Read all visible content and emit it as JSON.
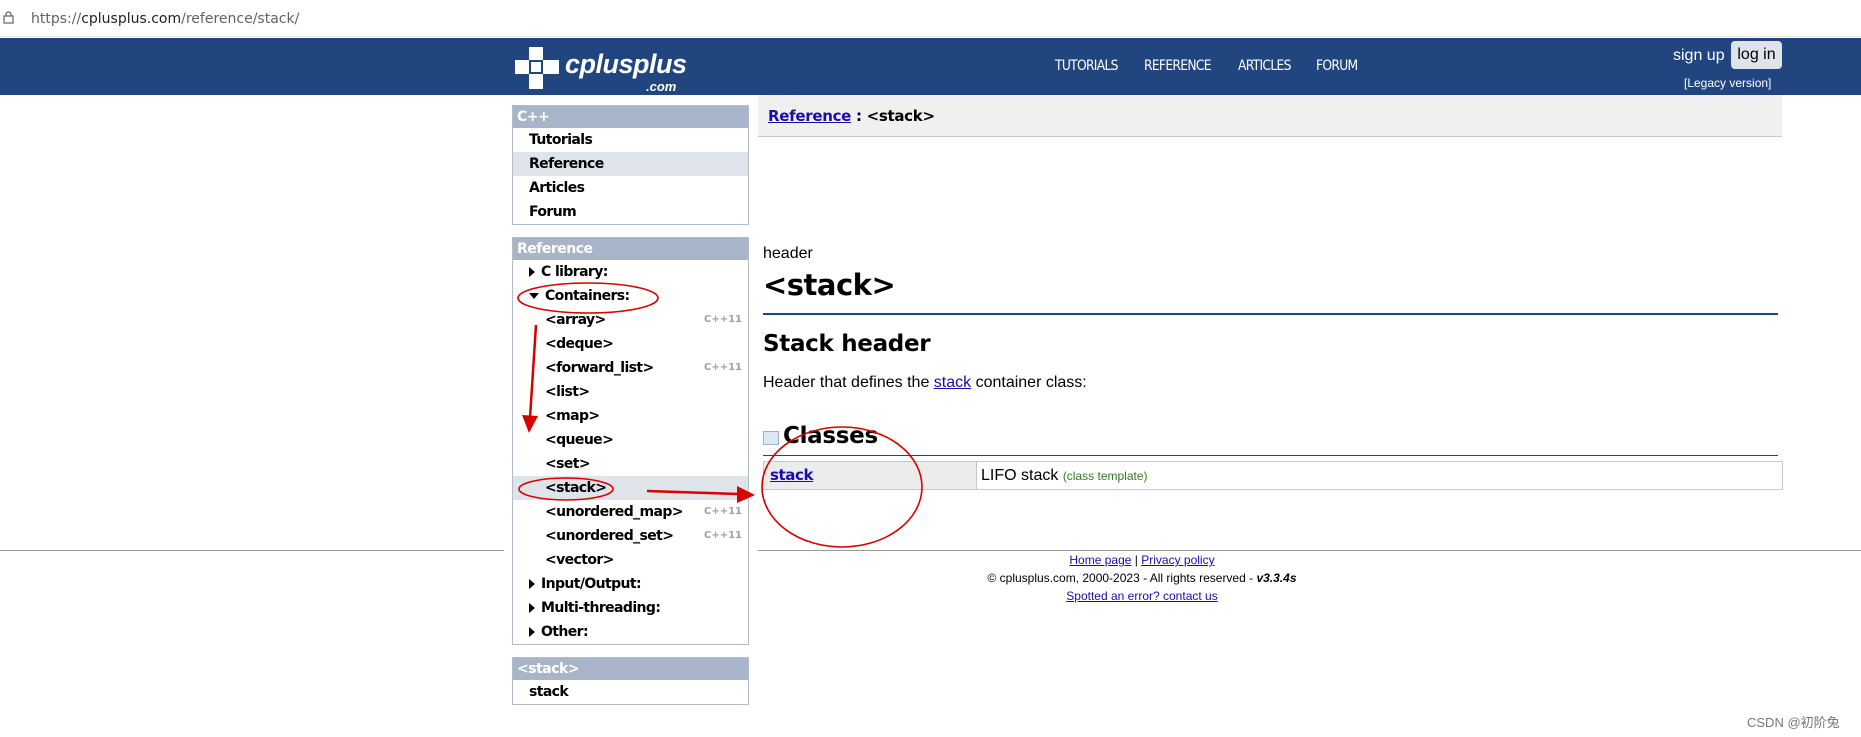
{
  "browser": {
    "url_prefix": "https://",
    "url_domain": "cplusplus.com",
    "url_path": "/reference/stack/"
  },
  "header": {
    "logo_text": "cplusplus",
    "logo_domain": ".com",
    "nav": [
      "TUTORIALS",
      "REFERENCE",
      "ARTICLES",
      "FORUM"
    ],
    "sign_up": "sign up",
    "log_in": "log in",
    "legacy": "[Legacy version]"
  },
  "sidebar": {
    "cpp_box": {
      "title": "C++",
      "items": [
        "Tutorials",
        "Reference",
        "Articles",
        "Forum"
      ],
      "selected": "Reference"
    },
    "ref_box": {
      "title": "Reference",
      "c_library": "C library:",
      "containers": "Containers:",
      "containers_items": [
        {
          "label": "<array>",
          "badge": "C++11"
        },
        {
          "label": "<deque>",
          "badge": ""
        },
        {
          "label": "<forward_list>",
          "badge": "C++11"
        },
        {
          "label": "<list>",
          "badge": ""
        },
        {
          "label": "<map>",
          "badge": ""
        },
        {
          "label": "<queue>",
          "badge": ""
        },
        {
          "label": "<set>",
          "badge": ""
        },
        {
          "label": "<stack>",
          "badge": ""
        },
        {
          "label": "<unordered_map>",
          "badge": "C++11"
        },
        {
          "label": "<unordered_set>",
          "badge": "C++11"
        },
        {
          "label": "<vector>",
          "badge": ""
        }
      ],
      "input_output": "Input/Output:",
      "multi_threading": "Multi-threading:",
      "other": "Other:"
    },
    "stack_box": {
      "title": "<stack>",
      "items": [
        "stack"
      ]
    }
  },
  "main": {
    "breadcrumb_link": "Reference",
    "breadcrumb_sep": " : ",
    "breadcrumb_current": "<stack>",
    "kind": "header",
    "title": "<stack>",
    "subtitle": "Stack header",
    "desc_before": "Header that defines the ",
    "desc_link": "stack",
    "desc_after": " container class:",
    "classes_heading": "Classes",
    "classes": [
      {
        "name": "stack",
        "description": "LIFO stack",
        "tag": "(class template)"
      }
    ]
  },
  "footer": {
    "home": "Home page",
    "sep": " | ",
    "privacy": "Privacy policy",
    "copyright": "© cplusplus.com, 2000-2023 - All rights reserved - ",
    "version": "v3.3.4s",
    "spotted": "Spotted an error? contact us"
  },
  "watermark": "CSDN @初阶兔",
  "colors": {
    "navbar": "#21457f",
    "box_header": "#a8b5c9",
    "annotation": "#d90000"
  }
}
